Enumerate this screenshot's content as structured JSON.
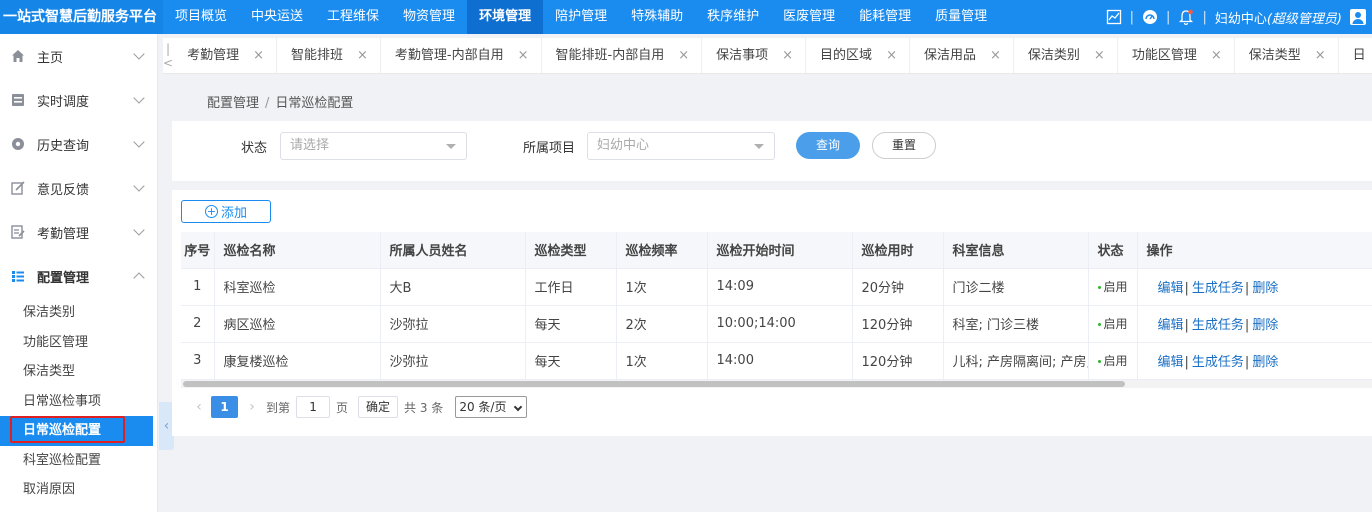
{
  "app": {
    "brand": "一站式智慧后勤服务平台"
  },
  "top_nav": {
    "items": [
      "项目概览",
      "中央运送",
      "工程维保",
      "物资管理",
      "环境管理",
      "陪护管理",
      "特殊辅助",
      "秩序维护",
      "医废管理",
      "能耗管理",
      "质量管理"
    ],
    "active": "环境管理"
  },
  "top_right": {
    "separator": "|",
    "org": "妇幼中心",
    "role": "(超级管理员)"
  },
  "sidebar": {
    "menus": [
      {
        "label": "主页",
        "icon": "home-icon"
      },
      {
        "label": "实时调度",
        "icon": "dispatch-icon"
      },
      {
        "label": "历史查询",
        "icon": "history-icon"
      },
      {
        "label": "意见反馈",
        "icon": "feedback-icon"
      },
      {
        "label": "考勤管理",
        "icon": "attendance-icon"
      },
      {
        "label": "配置管理",
        "icon": "config-icon"
      }
    ],
    "sub_items": [
      "保洁类别",
      "功能区管理",
      "保洁类型",
      "日常巡检事项",
      "日常巡检配置",
      "科室巡检配置",
      "取消原因"
    ],
    "active_sub": "日常巡检配置"
  },
  "tabs": {
    "items": [
      "考勤管理",
      "智能排班",
      "考勤管理-内部自用",
      "智能排班-内部自用",
      "保洁事项",
      "目的区域",
      "保洁用品",
      "保洁类别",
      "功能区管理",
      "保洁类型",
      "日"
    ],
    "close_glyph": "×",
    "prev_glyph": "|<",
    "next_glyph": "|<"
  },
  "breadcrumb": {
    "parent": "配置管理",
    "sep": "/",
    "current": "日常巡检配置"
  },
  "search": {
    "status_label": "状态",
    "status_placeholder": "请选择",
    "project_label": "所属项目",
    "project_value": "妇幼中心",
    "query_btn": "查询",
    "reset_btn": "重置"
  },
  "table": {
    "add_btn": "添加",
    "add_icon": "+",
    "headers": [
      "序号",
      "巡检名称",
      "所属人员姓名",
      "巡检类型",
      "巡检频率",
      "巡检开始时间",
      "巡检用时",
      "科室信息",
      "状态",
      "操作"
    ],
    "rows": [
      [
        "1",
        "科室巡检",
        "大B",
        "工作日",
        "1次",
        "14:09",
        "20分钟",
        "门诊二楼",
        "启用"
      ],
      [
        "2",
        "病区巡检",
        "沙弥拉",
        "每天",
        "2次",
        "10:00;14:00",
        "120分钟",
        "科室; 门诊三楼",
        "启用"
      ],
      [
        "3",
        "康复楼巡检",
        "沙弥拉",
        "每天",
        "1次",
        "14:00",
        "120分钟",
        "儿科; 产房隔离间; 产房;",
        "启用"
      ]
    ],
    "ops": {
      "edit": "编辑",
      "gen": "生成任务",
      "del": "删除",
      "sep": "|"
    }
  },
  "pagination": {
    "prev": "‹",
    "next": "›",
    "current_page": "1",
    "goto_label": "到第",
    "goto_value": "1",
    "page_unit": "页",
    "confirm": "确定",
    "total": "共 3 条",
    "page_size": "20 条/页"
  },
  "colors": {
    "primary": "#1a8cf0",
    "highlight_box": "#e02020"
  }
}
